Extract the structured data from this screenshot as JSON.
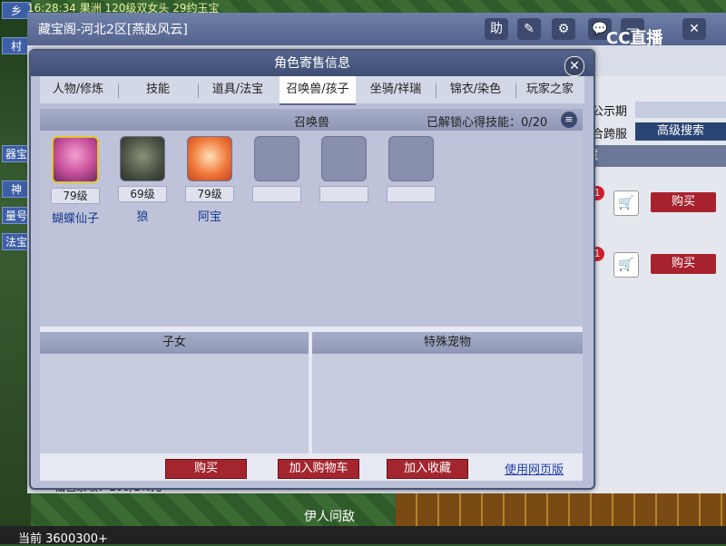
{
  "background": {
    "topbar_text": "16:28:34  果洲   120级双女头   29约玉宝",
    "left_labels": [
      "乡",
      "村",
      "器宝",
      "神",
      "量号",
      "法宝"
    ],
    "window_title": "藏宝阁-河北2区[燕赵风云]",
    "header_buttons": [
      "助",
      "✎",
      "⚙",
      "💬",
      "—",
      "✕"
    ],
    "cc_logo": "CC直播",
    "public_label": "公示期",
    "cross_label": "合跨服",
    "adv_search": "高级搜索",
    "dark_bar_text": "藏",
    "buy_label": "购买",
    "badge": "1",
    "chat_text": "仙色录取：100/1%元",
    "fight_text": "伊人问敌",
    "bottom_text": "当前  3600300+"
  },
  "dialog": {
    "title": "角色寄售信息",
    "close_label": "✕",
    "tabs": [
      {
        "label": "人物/修炼"
      },
      {
        "label": "技能"
      },
      {
        "label": "道具/法宝"
      },
      {
        "label": "召唤兽/孩子"
      },
      {
        "label": "坐骑/祥瑞"
      },
      {
        "label": "锦衣/染色"
      },
      {
        "label": "玩家之家"
      }
    ],
    "active_tab": "召唤兽/孩子",
    "pets_header": "召唤兽",
    "skill_unlock": "已解锁心得技能：0/20",
    "pets": [
      {
        "level": "79级",
        "name": "蝴蝶仙子",
        "icon": "butterfly-fairy-portrait"
      },
      {
        "level": "69级",
        "name": "狼",
        "icon": "wolf-portrait"
      },
      {
        "level": "79级",
        "name": "阿宝",
        "icon": "abao-portrait"
      }
    ],
    "children_header": "子女",
    "special_pets_header": "特殊宠物",
    "buttons": {
      "buy": "购买",
      "add_cart": "加入购物车",
      "favorite": "加入收藏",
      "web_version": "使用网页版"
    }
  }
}
